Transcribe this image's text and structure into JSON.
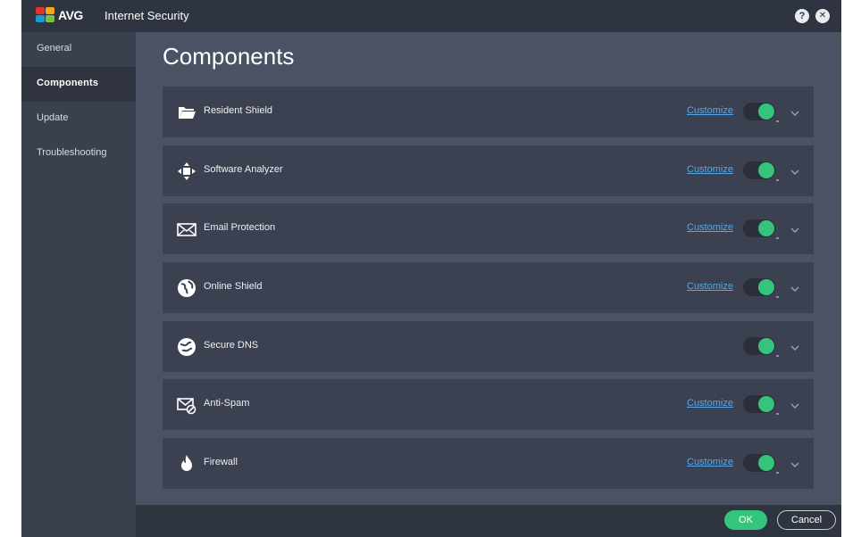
{
  "titlebar": {
    "logo_text": "AVG",
    "title": "Internet Security",
    "help_label": "?",
    "close_label": "✕"
  },
  "sidebar": {
    "items": [
      {
        "label": "General",
        "active": false
      },
      {
        "label": "Components",
        "active": true
      },
      {
        "label": "Update",
        "active": false
      },
      {
        "label": "Troubleshooting",
        "active": false
      }
    ]
  },
  "main": {
    "title": "Components",
    "components": [
      {
        "label": "Resident Shield",
        "icon": "folder-icon",
        "customize": "Customize",
        "enabled": true
      },
      {
        "label": "Software Analyzer",
        "icon": "move-arrows-icon",
        "customize": "Customize",
        "enabled": true
      },
      {
        "label": "Email Protection",
        "icon": "envelope-icon",
        "customize": "Customize",
        "enabled": true
      },
      {
        "label": "Online Shield",
        "icon": "globe-icon",
        "customize": "Customize",
        "enabled": true
      },
      {
        "label": "Secure DNS",
        "icon": "dns-globe-icon",
        "customize": "",
        "enabled": true
      },
      {
        "label": "Anti-Spam",
        "icon": "envelope-block-icon",
        "customize": "Customize",
        "enabled": true
      },
      {
        "label": "Firewall",
        "icon": "flame-icon",
        "customize": "Customize",
        "enabled": true
      }
    ]
  },
  "footer": {
    "ok_label": "OK",
    "cancel_label": "Cancel"
  },
  "colors": {
    "accent_green": "#35c47c",
    "link_blue": "#56a8e8"
  }
}
